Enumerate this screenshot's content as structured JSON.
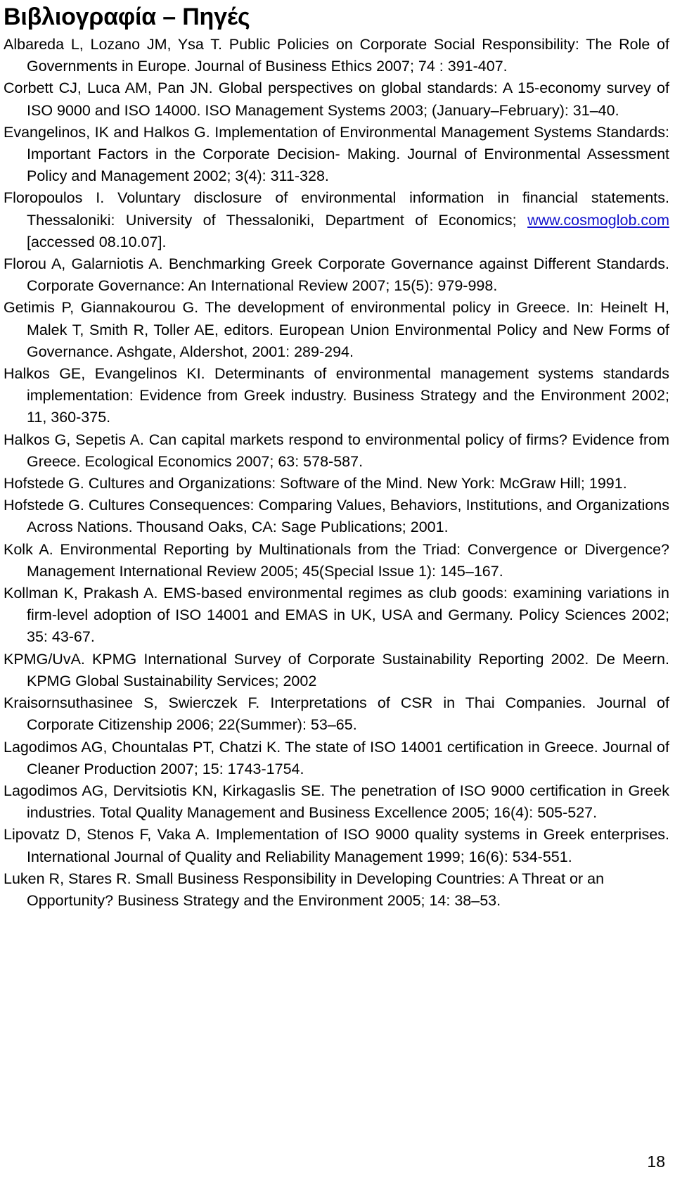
{
  "document": {
    "title": "Βιβλιογραφία – Πηγές",
    "page_number": "18",
    "link_color": "#1111cc",
    "text_color": "#000000",
    "background_color": "#ffffff"
  },
  "references": [
    {
      "id": "ref-albareda",
      "text": "Albareda L, Lozano JM, Ysa T. Public Policies on Corporate Social Responsibility: The Role of Governments in Europe. Journal of Business Ethics 2007; 74 : 391-407."
    },
    {
      "id": "ref-corbett",
      "text": "Corbett CJ, Luca AM, Pan JN. Global perspectives on global standards: A 15-economy survey of ISO 9000 and ISO 14000. ISO Management Systems 2003; (January–February): 31–40."
    },
    {
      "id": "ref-evangelinos",
      "text": "Evangelinos, IK and Halkos G. Implementation of Environmental Management Systems Standards: Important Factors in the Corporate Decision- Making. Journal of Environmental Assessment Policy and Management 2002; 3(4): 311-328."
    },
    {
      "id": "ref-floropoulos",
      "prefix": "Floropoulos I. Voluntary disclosure of environmental information in financial statements. Thessaloniki: University of Thessaloniki, Department of Economics; ",
      "link": "www.cosmoglob.com",
      "suffix": " [accessed 08.10.07]."
    },
    {
      "id": "ref-florou",
      "text": "Florou A, Galarniotis A. Benchmarking Greek Corporate Governance against Different Standards. Corporate Governance: An International Review 2007; 15(5): 979-998."
    },
    {
      "id": "ref-getimis",
      "text": "Getimis P, Giannakourou G. The development of environmental policy in Greece. In: Heinelt H, Malek T, Smith R, Toller AE, editors. European Union Environmental Policy and New Forms of Governance. Ashgate, Aldershot, 2001: 289-294."
    },
    {
      "id": "ref-halkos-evangelinos",
      "text": "Halkos GE, Evangelinos KI. Determinants of environmental management systems standards implementation: Evidence from Greek industry. Business Strategy and the Environment 2002; 11, 360-375."
    },
    {
      "id": "ref-halkos-sepetis",
      "text": "Halkos G, Sepetis A. Can capital markets respond to environmental policy of firms? Evidence from Greece. Ecological Economics 2007; 63: 578-587."
    },
    {
      "id": "ref-hofstede-1991",
      "text": "Hofstede G. Cultures and Organizations: Software of the Mind. New York: McGraw Hill; 1991."
    },
    {
      "id": "ref-hofstede-2001",
      "text": "Hofstede G. Cultures Consequences: Comparing Values, Behaviors, Institutions, and Organizations Across Nations. Thousand Oaks, CA: Sage Publications; 2001."
    },
    {
      "id": "ref-kolk",
      "text": "Kolk A. Environmental Reporting by Multinationals from the Triad: Convergence or Divergence? Management International Review 2005; 45(Special Issue 1): 145–167."
    },
    {
      "id": "ref-kollman",
      "text": "Kollman K, Prakash A. EMS-based environmental regimes as club goods: examining variations in firm-level adoption of ISO 14001 and EMAS in UK, USA and Germany. Policy Sciences 2002; 35: 43-67."
    },
    {
      "id": "ref-kpmg",
      "text": "KPMG/UvA. KPMG International Survey of Corporate Sustainability Reporting 2002. De Meern. KPMG Global Sustainability Services; 2002"
    },
    {
      "id": "ref-kraisornsuthasinee",
      "text": "Kraisornsuthasinee S, Swierczek F. Interpretations of CSR in Thai Companies. Journal of Corporate Citizenship 2006; 22(Summer): 53–65."
    },
    {
      "id": "ref-lagodimos-chountalas",
      "text": "Lagodimos AG, Chountalas PT, Chatzi K. The state of ISO 14001 certification in Greece. Journal of Cleaner Production 2007; 15: 1743-1754."
    },
    {
      "id": "ref-lagodimos-dervitsiotis",
      "text": "Lagodimos AG, Dervitsiotis KN, Kirkagaslis SE. The penetration of ISO 9000 certification in Greek industries. Total Quality Management and Business Excellence 2005; 16(4): 505-527."
    },
    {
      "id": "ref-lipovatz",
      "text": "Lipovatz D, Stenos F, Vaka A. Implementation of ISO 9000 quality systems in Greek enterprises. International Journal of Quality and Reliability Management 1999; 16(6): 534-551."
    },
    {
      "id": "ref-luken",
      "text": "Luken R, Stares R. Small Business Responsibility in Developing Countries: A Threat or an Opportunity? Business Strategy and the Environment 2005; 14: 38–53."
    }
  ]
}
